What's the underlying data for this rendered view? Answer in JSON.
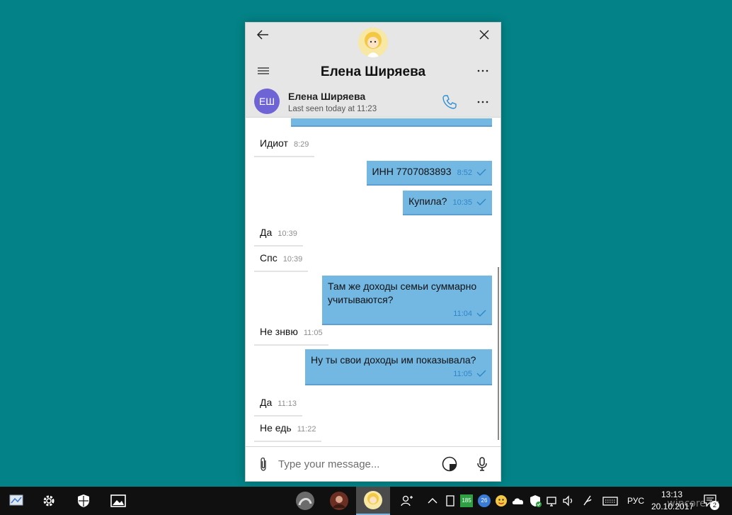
{
  "window": {
    "title": "Елена Ширяева"
  },
  "contact": {
    "initials": "ЕШ",
    "name": "Елена Ширяева",
    "status": "Last seen today at 11:23"
  },
  "messages": [
    {
      "dir": "in",
      "text": "Идиот",
      "time": "8:29"
    },
    {
      "dir": "out",
      "text": "ИНН 7707083893",
      "time": "8:52"
    },
    {
      "dir": "out",
      "text": "Купила?",
      "time": "10:35"
    },
    {
      "dir": "in",
      "text": "Да",
      "time": "10:39"
    },
    {
      "dir": "in",
      "text": "Спс",
      "time": "10:39"
    },
    {
      "dir": "out",
      "text": "Там же доходы семьи суммарно учитываются?",
      "time": "11:04"
    },
    {
      "dir": "in",
      "text": "Не знвю",
      "time": "11:05"
    },
    {
      "dir": "out",
      "text": "Ну ты свои доходы им показывала?",
      "time": "11:05"
    },
    {
      "dir": "in",
      "text": "Да",
      "time": "11:13"
    },
    {
      "dir": "in",
      "text": "Не едь",
      "time": "11:22"
    }
  ],
  "input": {
    "placeholder": "Type your message..."
  },
  "taskbar": {
    "tray_badge": "185",
    "tray_badge2": "26",
    "language": "РУС",
    "time": "13:13",
    "date": "20.10.2017",
    "notifications": "2",
    "watermark": "wincore.ru"
  },
  "colors": {
    "desktop": "#038387",
    "outgoing_bubble": "#73b7e3",
    "avatar": "#6f64d6"
  }
}
